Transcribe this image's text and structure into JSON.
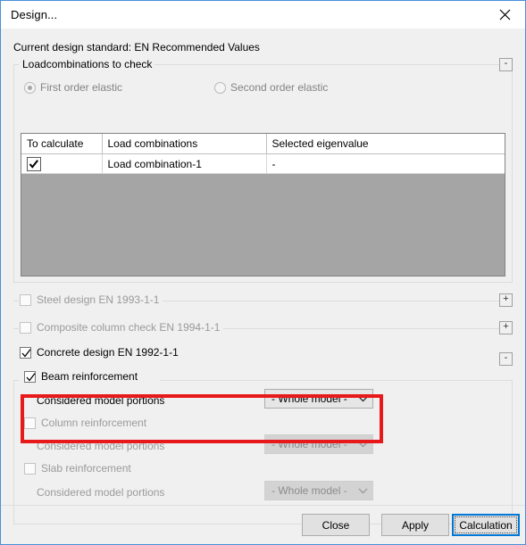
{
  "window": {
    "title": "Design...",
    "close_icon": "close-icon"
  },
  "header": {
    "design_standard": "Current design standard: EN Recommended Values"
  },
  "loadcombinations_group": {
    "title": "Loadcombinations to check",
    "collapse_symbol": "-",
    "radios": [
      {
        "label": "First order elastic",
        "selected": true,
        "disabled": true
      },
      {
        "label": "Second order elastic",
        "selected": false,
        "disabled": true
      }
    ],
    "table": {
      "columns": [
        "To calculate",
        "Load combinations",
        "Selected eigenvalue"
      ],
      "rows": [
        {
          "to_calculate": true,
          "load_combination": "Load combination-1",
          "selected_eigenvalue": "-"
        }
      ]
    }
  },
  "sections": [
    {
      "label": "Steel design EN 1993-1-1",
      "checked": false,
      "disabled": true,
      "toggle_symbol": "+"
    },
    {
      "label": "Composite column check EN 1994-1-1",
      "checked": false,
      "disabled": true,
      "toggle_symbol": "+"
    },
    {
      "label": "Concrete design EN 1992-1-1",
      "checked": true,
      "disabled": false,
      "toggle_symbol": "-"
    }
  ],
  "concrete_design": {
    "items": [
      {
        "label": "Beam reinforcement",
        "checked": true,
        "disabled": false,
        "portions_label": "Considered model portions",
        "portions_value": "- Whole model -",
        "highlighted": true
      },
      {
        "label": "Column reinforcement",
        "checked": false,
        "disabled": true,
        "portions_label": "Considered model portions",
        "portions_value": "- Whole model -",
        "highlighted": false
      },
      {
        "label": "Slab reinforcement",
        "checked": false,
        "disabled": true,
        "portions_label": "Considered model portions",
        "portions_value": "- Whole model -",
        "highlighted": false
      }
    ]
  },
  "footer": {
    "close_label": "Close",
    "apply_label": "Apply",
    "calculation_label": "Calculation"
  },
  "colors": {
    "highlight": "#e8191b",
    "accent": "#0078d7",
    "window_border": "#4a90d9",
    "table_empty": "#a5a5a5"
  }
}
